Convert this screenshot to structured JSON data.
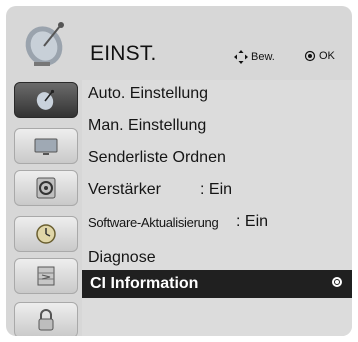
{
  "header": {
    "title": "EINST.",
    "move_hint": "Bew.",
    "ok_hint": "OK"
  },
  "sidebar": {
    "header_icon": "satellite-dish-icon",
    "items": [
      {
        "icon": "satellite-dish-icon",
        "active": true
      },
      {
        "icon": "tv-screen-icon",
        "active": false
      },
      {
        "icon": "speaker-icon",
        "active": false
      },
      {
        "icon": "clock-icon",
        "active": false
      },
      {
        "icon": "lock-grid-icon",
        "active": false
      },
      {
        "icon": "padlock-icon",
        "active": false
      }
    ]
  },
  "menu": {
    "items": [
      {
        "label": "Auto. Einstellung",
        "value": ""
      },
      {
        "label": "Man. Einstellung",
        "value": ""
      },
      {
        "label": "Senderliste Ordnen",
        "value": ""
      },
      {
        "label": "Verstärker",
        "value": ": Ein"
      },
      {
        "label": "Software-Aktualisierung",
        "value": ": Ein"
      },
      {
        "label": "Diagnose",
        "value": ""
      },
      {
        "label": "CI Information",
        "value": "",
        "selected": true
      }
    ]
  },
  "colors": {
    "frame_bg": "#d7d7d7",
    "selected_bg": "#202020",
    "selected_text": "#ffffff",
    "text": "#151515"
  }
}
